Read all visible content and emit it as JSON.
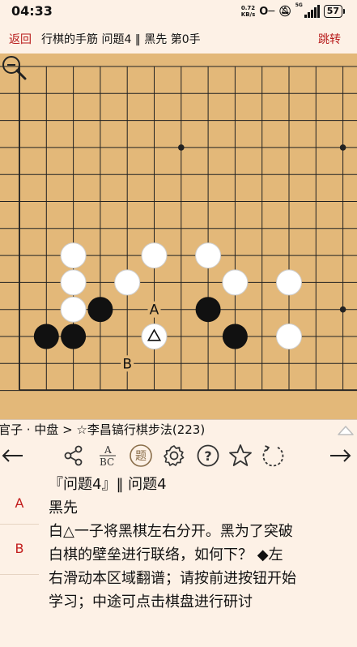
{
  "status_bar": {
    "time": "04:33",
    "net_speed_value": "0.72",
    "net_speed_unit": "KB/s",
    "network": "5G",
    "battery": "57"
  },
  "header": {
    "back_label": "返回",
    "title": "行棋的手筋 问题4 ‖ 黑先 第0手",
    "jump_label": "跳转"
  },
  "board": {
    "size": 19,
    "visible_columns": "partial left edge + 17",
    "hoshi": [
      [
        6,
        3
      ],
      [
        12,
        3
      ],
      [
        12,
        9
      ]
    ],
    "stones": [
      {
        "color": "white",
        "col": 2,
        "row": 7
      },
      {
        "color": "white",
        "col": 5,
        "row": 7
      },
      {
        "color": "white",
        "col": 7,
        "row": 7
      },
      {
        "color": "white",
        "col": 2,
        "row": 8
      },
      {
        "color": "white",
        "col": 4,
        "row": 8
      },
      {
        "color": "white",
        "col": 8,
        "row": 8
      },
      {
        "color": "white",
        "col": 10,
        "row": 8
      },
      {
        "color": "white",
        "col": 2,
        "row": 9
      },
      {
        "color": "black",
        "col": 3,
        "row": 9
      },
      {
        "color": "black",
        "col": 7,
        "row": 9
      },
      {
        "color": "black",
        "col": 1,
        "row": 10
      },
      {
        "color": "black",
        "col": 2,
        "row": 10
      },
      {
        "color": "white",
        "col": 5,
        "row": 10,
        "marker": "triangle"
      },
      {
        "color": "black",
        "col": 8,
        "row": 10
      },
      {
        "color": "white",
        "col": 10,
        "row": 10
      }
    ],
    "labels": [
      {
        "text": "A",
        "col": 5,
        "row": 9
      },
      {
        "text": "B",
        "col": 4,
        "row": 11
      }
    ],
    "colors": {
      "wood": "#e3b879",
      "line": "#222222",
      "black_stone": "#111111",
      "white_stone": "#ffffff"
    }
  },
  "breadcrumb": "官子 · 中盘 > ☆李昌镐行棋步法(223)",
  "toolbar": {
    "icons": [
      "arrow-left-icon",
      "share-icon",
      "abc-icon",
      "problem-icon",
      "gear-icon",
      "help-icon",
      "star-icon",
      "refresh-icon",
      "arrow-right-icon"
    ],
    "abc_top": "A",
    "abc_bottom": "BC",
    "problem_char": "题",
    "help_char": "?"
  },
  "choices": [
    "A",
    "B"
  ],
  "content": {
    "line1": "『问题4』‖ 问题4",
    "line2": "黑先",
    "line3": "白△一子将黑棋左右分开。黑为了突破",
    "line4": "白棋的壁垒进行联络，如何下？   ◆左",
    "line5": "右滑动本区域翻谱；请按前进按钮开始",
    "line6": "学习；中途可点击棋盘进行研讨"
  },
  "accent_color": "#b81b1b"
}
